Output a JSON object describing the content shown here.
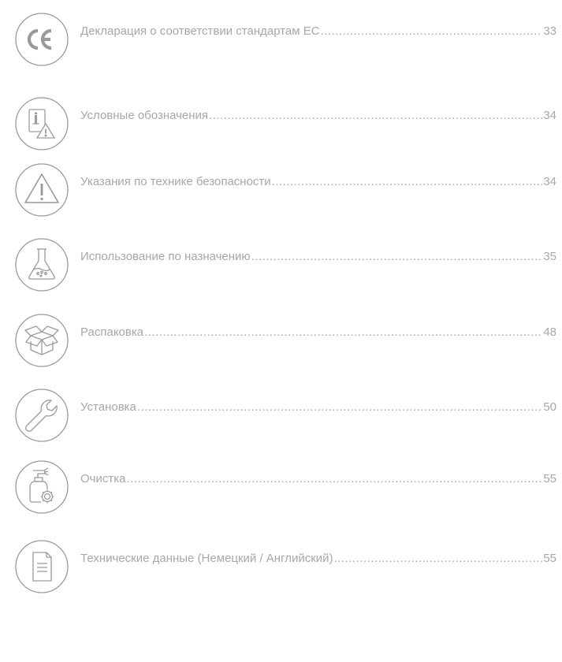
{
  "toc": {
    "entries": [
      {
        "icon": "ce-mark-icon",
        "label": "Декларация о соответствии стандартам ЕС",
        "page": "33"
      },
      {
        "icon": "info-warning-icon",
        "label": "Условные обозначения",
        "page": "34"
      },
      {
        "icon": "warning-triangle-icon",
        "label": "Указания по технике безопасности",
        "page": "34"
      },
      {
        "icon": "flask-icon",
        "label": "Использование по назначению",
        "page": "35"
      },
      {
        "icon": "open-box-icon",
        "label": "Распаковка",
        "page": "48"
      },
      {
        "icon": "wrench-icon",
        "label": "Установка",
        "page": "50"
      },
      {
        "icon": "spray-bottle-gear-icon",
        "label": "Очистка",
        "page": "55"
      },
      {
        "icon": "document-icon",
        "label": "Технические данные (Немецкий / Английский)",
        "page": "55"
      }
    ]
  },
  "colors": {
    "text": "#a7a7a7",
    "icon_stroke": "#9a9a9a"
  }
}
